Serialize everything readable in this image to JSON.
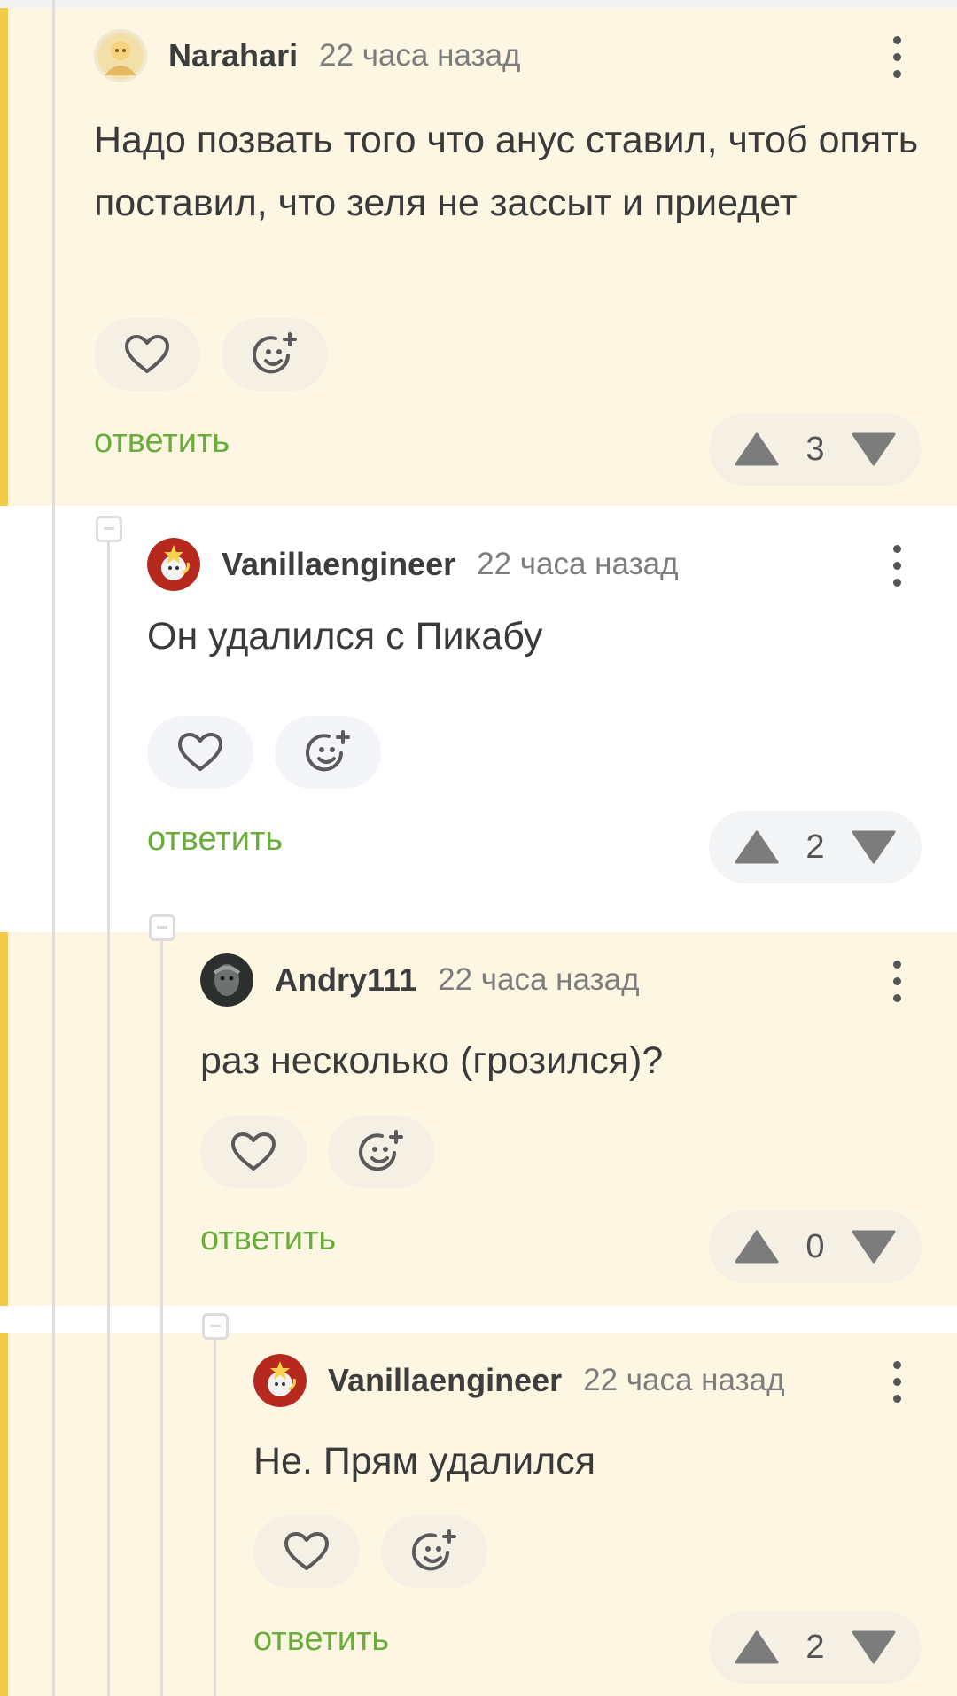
{
  "comments": [
    {
      "username": "Narahari",
      "time": "22 часа назад",
      "text": "Надо позвать того что анус ставил, чтоб опять поставил, что зеля не зассыт и приедет",
      "reply": "ответить",
      "score": "3",
      "avatar": "avatar-narahari"
    },
    {
      "username": "Vanillaengineer",
      "time": "22 часа назад",
      "text": "Он удалился с Пикабу",
      "reply": "ответить",
      "score": "2",
      "avatar": "avatar-vanillaengineer"
    },
    {
      "username": "Andry111",
      "time": "22 часа назад",
      "text": "раз несколько (грозился)?",
      "reply": "ответить",
      "score": "0",
      "avatar": "avatar-andry111"
    },
    {
      "username": "Vanillaengineer",
      "time": "22 часа назад",
      "text": "Не. Прям удалился",
      "reply": "ответить",
      "score": "2",
      "avatar": "avatar-vanillaengineer"
    }
  ],
  "icons": {
    "like": "heart-icon",
    "react": "emoji-add-icon",
    "upvote": "upvote-icon",
    "downvote": "downvote-icon",
    "more": "more-vert-icon",
    "collapse": "collapse-icon"
  },
  "colors": {
    "highlight_bg": "#fcf6e3",
    "highlight_bar": "#f4ca4b",
    "reply_link": "#6aad3d"
  }
}
